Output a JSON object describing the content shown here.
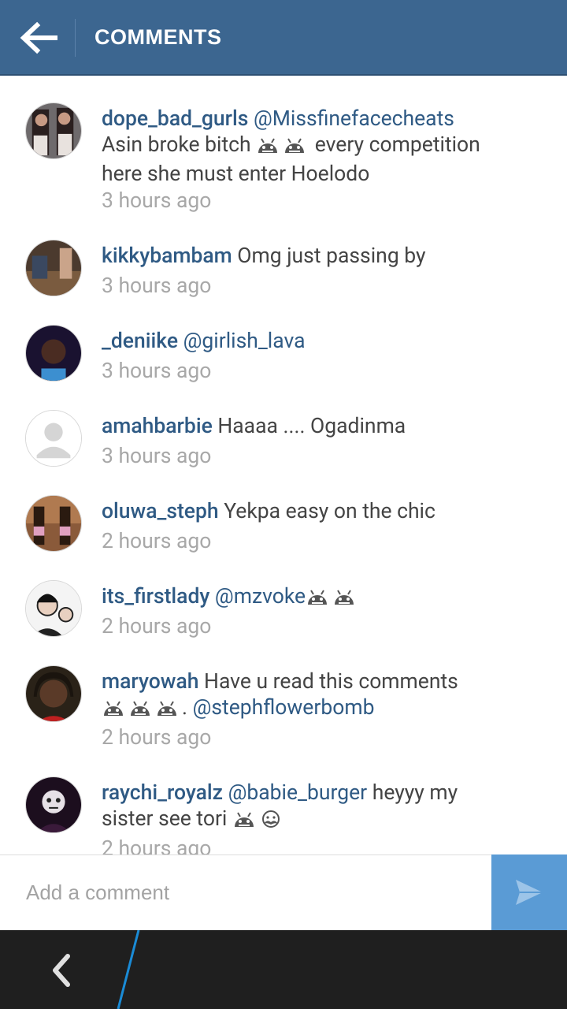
{
  "header": {
    "title": "COMMENTS"
  },
  "comments": [
    {
      "user": "dope_bad_gurls",
      "line1_parts": [
        "@Missfinefacecheats"
      ],
      "line2": "Asin broke bitch",
      "line2_after": " every competition",
      "line3": "here she must enter Hoelodo",
      "time": "3 hours ago"
    },
    {
      "user": "kikkybambam",
      "text": " Omg just passing by",
      "time": "3 hours ago"
    },
    {
      "user": "_deniike",
      "mention": " @girlish_lava",
      "time": "3 hours ago"
    },
    {
      "user": "amahbarbie",
      "text": " Haaaa .... Ogadinma",
      "time": "3 hours ago"
    },
    {
      "user": "oluwa_steph",
      "text": " Yekpa easy on the chic",
      "time": "2 hours ago"
    },
    {
      "user": "its_firstlady",
      "mention": " @mzvoke",
      "time": "2 hours ago"
    },
    {
      "user": "maryowah",
      "text": " Have u read this comments",
      "line2_sep": ". ",
      "mention": "@stephflowerbomb",
      "time": "2 hours ago"
    },
    {
      "user": "raychi_royalz",
      "mention": " @babie_burger",
      "text": " heyyy my",
      "line2": "sister see tori",
      "time": "2 hours ago"
    }
  ],
  "composer": {
    "placeholder": "Add a comment"
  },
  "icons": {
    "back": "back-arrow-icon",
    "send": "send-icon",
    "nav_back": "chevron-left-icon",
    "emoji": "android-face-emoji"
  },
  "colors": {
    "header": "#3c6690",
    "link": "#2f5a84",
    "send_button": "#5a9bd5",
    "navbar": "#1f1f1f"
  }
}
